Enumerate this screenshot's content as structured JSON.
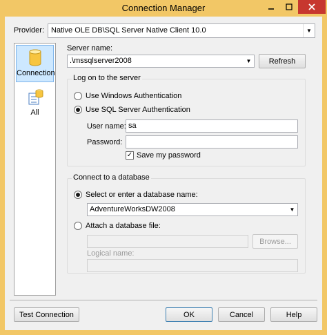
{
  "window": {
    "title": "Connection Manager"
  },
  "provider": {
    "label": "Provider:",
    "value": "Native OLE DB\\SQL Server Native Client 10.0"
  },
  "nav": [
    {
      "label": "Connection",
      "icon": "database-cylinder-icon"
    },
    {
      "label": "All",
      "icon": "all-properties-icon"
    }
  ],
  "server": {
    "label": "Server name:",
    "value": ".\\mssqlserver2008",
    "refresh_label": "Refresh"
  },
  "logon": {
    "title": "Log on to the server",
    "windows_auth": "Use Windows Authentication",
    "sql_auth": "Use SQL Server Authentication",
    "selected": "sql_auth",
    "username_label": "User name:",
    "username_value": "sa",
    "password_label": "Password:",
    "password_value": "",
    "save_password_label": "Save my password",
    "save_password_checked": true
  },
  "database": {
    "title": "Connect to a database",
    "select_label": "Select or enter a database name:",
    "select_value": "AdventureWorksDW2008",
    "attach_label": "Attach a database file:",
    "attach_value": "",
    "browse_label": "Browse...",
    "logical_name_label": "Logical name:",
    "logical_name_value": "",
    "selected": "select"
  },
  "footer": {
    "test_label": "Test Connection",
    "ok_label": "OK",
    "cancel_label": "Cancel",
    "help_label": "Help"
  },
  "colors": {
    "frame": "#f2c766",
    "close": "#c7372f",
    "selection": "#cde8ff"
  }
}
